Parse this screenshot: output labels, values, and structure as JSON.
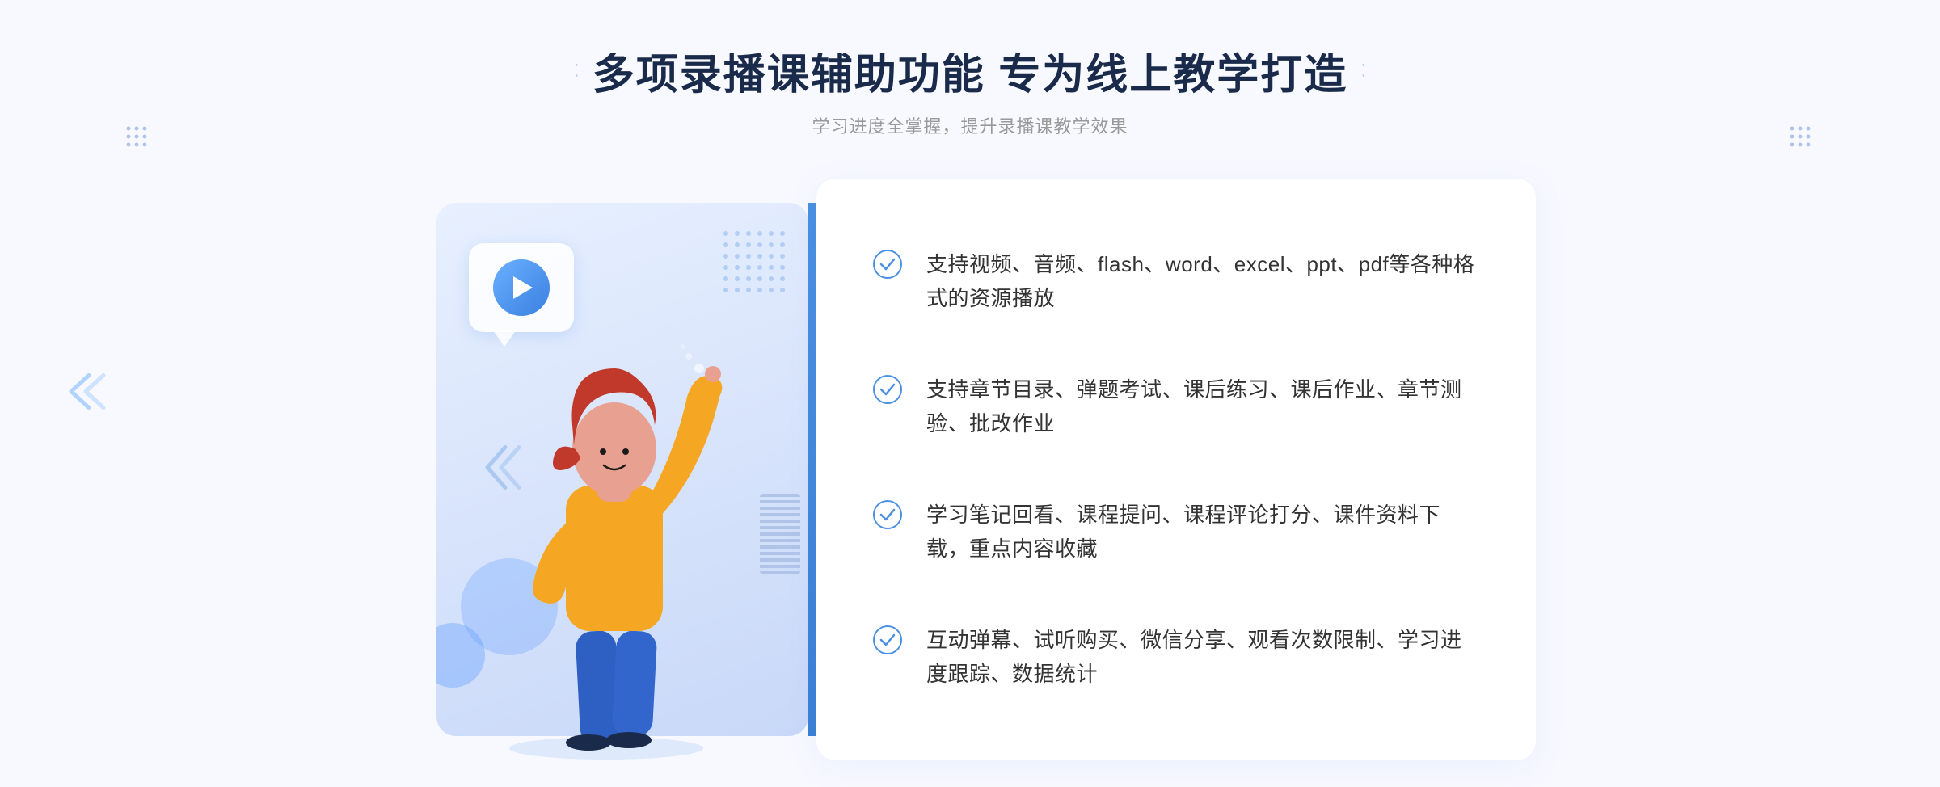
{
  "header": {
    "title": "多项录播课辅助功能 专为线上教学打造",
    "subtitle": "学习进度全掌握，提升录播课教学效果",
    "decorator_dots": "⁚"
  },
  "features": [
    {
      "id": 1,
      "text": "支持视频、音频、flash、word、excel、ppt、pdf等各种格式的资源播放"
    },
    {
      "id": 2,
      "text": "支持章节目录、弹题考试、课后练习、课后作业、章节测验、批改作业"
    },
    {
      "id": 3,
      "text": "学习笔记回看、课程提问、课程评论打分、课件资料下载，重点内容收藏"
    },
    {
      "id": 4,
      "text": "互动弹幕、试听购买、微信分享、观看次数限制、学习进度跟踪、数据统计"
    }
  ],
  "colors": {
    "primary_blue": "#4a90e2",
    "light_blue": "#6ab0ff",
    "bg_light": "#f0f5ff",
    "text_dark": "#1a2a4a",
    "text_gray": "#999999",
    "check_color": "#4a90e2"
  },
  "illustration": {
    "play_button_label": "play",
    "figure_label": "teaching illustration"
  }
}
